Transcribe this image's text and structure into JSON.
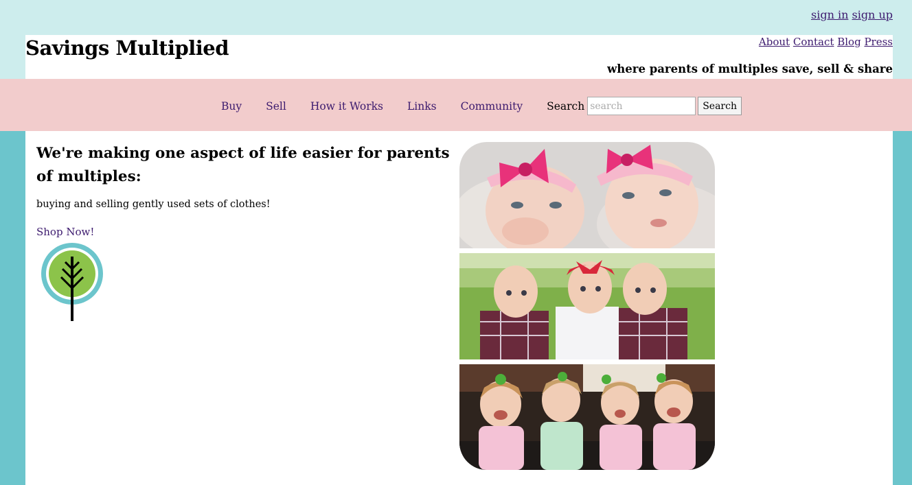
{
  "auth": {
    "sign_in": "sign in",
    "sign_up": "sign up"
  },
  "site": {
    "title": "Savings Multiplied",
    "tagline": "where parents of multiples save, sell & share"
  },
  "top_links": [
    "About",
    "Contact",
    "Blog",
    "Press"
  ],
  "nav": {
    "items": [
      "Buy",
      "Sell",
      "How it Works",
      "Links",
      "Community"
    ],
    "search_label": "Search",
    "search_placeholder": "search",
    "search_button": "Search"
  },
  "main": {
    "headline": "We're making one aspect of life easier for parents of multiples:",
    "subline": "buying and selling gently used sets of clothes!",
    "cta": "Shop Now!"
  },
  "icons": {
    "logo": "tree-logo-icon"
  },
  "colors": {
    "page_bg": "#6cc5cc",
    "top_band": "#cdeded",
    "nav_bar": "#f2cccc",
    "link": "#3c1a6e"
  }
}
